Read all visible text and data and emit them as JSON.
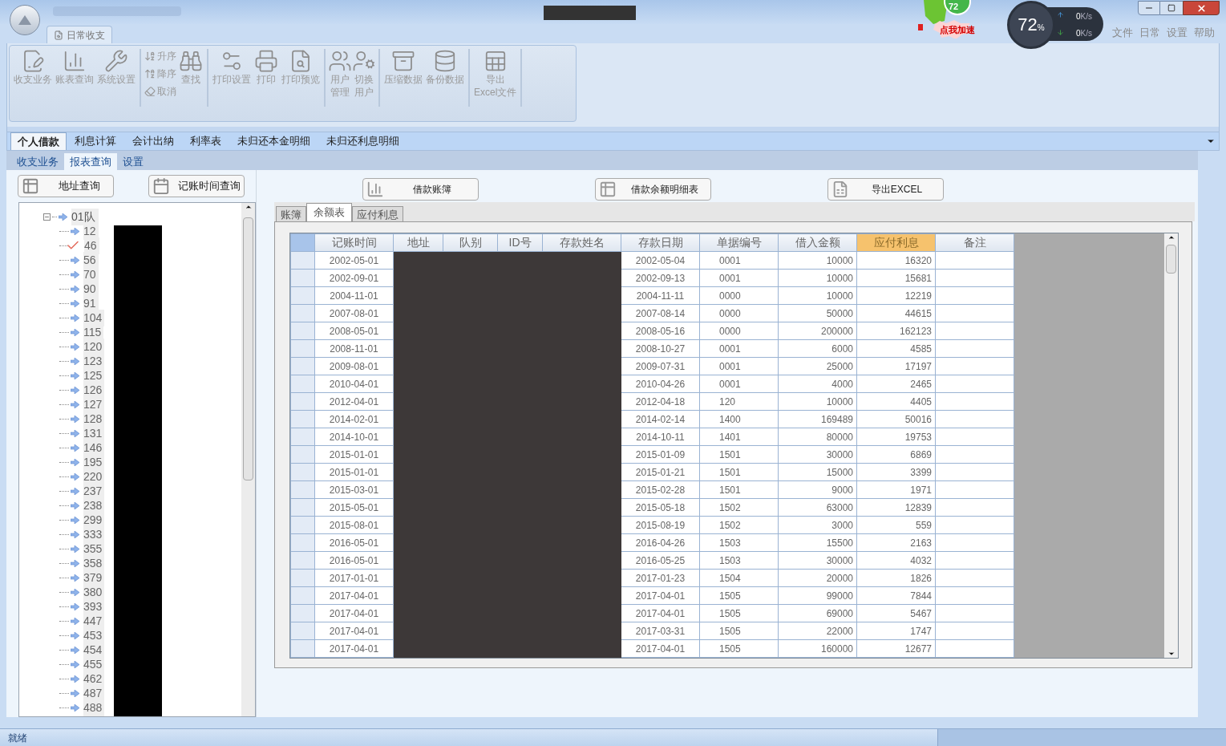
{
  "window": {
    "menu": [
      "文件",
      "日常",
      "设置",
      "帮助"
    ]
  },
  "overlay": {
    "badge": "72",
    "accelerate": "点我加速",
    "cpu": "72",
    "cpu_unit": "%",
    "up": "0",
    "up_unit": "K/s",
    "down": "0",
    "down_unit": "K/s"
  },
  "ribbon": {
    "tab": "日常收支",
    "groups": [
      {
        "kind": "large",
        "buttons": [
          "收支业务",
          "账表查询",
          "系统设置"
        ]
      },
      {
        "kind": "sort",
        "buttons": [
          "升序",
          "降序",
          "取消"
        ],
        "large": "查找"
      },
      {
        "kind": "large",
        "buttons": [
          "打印设置",
          "打印",
          "打印预览"
        ]
      },
      {
        "kind": "large",
        "buttons": [
          "用户管理",
          "切换用户"
        ]
      },
      {
        "kind": "large",
        "buttons": [
          "压缩数据",
          "备份数据"
        ]
      },
      {
        "kind": "large",
        "buttons": [
          "导出\nExcel文件"
        ]
      }
    ]
  },
  "main_tabs": [
    {
      "label": "个人借款",
      "selected": true
    },
    {
      "label": "利息计算",
      "selected": false
    },
    {
      "label": "会计出纳",
      "selected": false
    },
    {
      "label": "利率表",
      "selected": false
    },
    {
      "label": "未归还本金明细",
      "selected": false
    },
    {
      "label": "未归还利息明细",
      "selected": false
    }
  ],
  "sub_tabs": [
    {
      "label": "收支业务",
      "selected": false
    },
    {
      "label": "报表查询",
      "selected": true
    },
    {
      "label": "设置",
      "selected": false
    }
  ],
  "query_buttons": [
    "地址查询",
    "记账时间查询"
  ],
  "report_buttons": [
    "借款账簿",
    "借款余额明细表",
    "导出EXCEL"
  ],
  "tree": {
    "label": "01队",
    "expanded": true,
    "children": [
      {
        "label": "12",
        "checked": false
      },
      {
        "label": "46",
        "checked": true
      },
      {
        "label": "56",
        "checked": false
      },
      {
        "label": "70",
        "checked": false
      },
      {
        "label": "90",
        "checked": false
      },
      {
        "label": "91",
        "checked": false
      },
      {
        "label": "104",
        "checked": false
      },
      {
        "label": "115",
        "checked": false
      },
      {
        "label": "120",
        "checked": false
      },
      {
        "label": "123",
        "checked": false
      },
      {
        "label": "125",
        "checked": false
      },
      {
        "label": "126",
        "checked": false
      },
      {
        "label": "127",
        "checked": false
      },
      {
        "label": "128",
        "checked": false
      },
      {
        "label": "131",
        "checked": false
      },
      {
        "label": "146",
        "checked": false
      },
      {
        "label": "195",
        "checked": false
      },
      {
        "label": "220",
        "checked": false
      },
      {
        "label": "237",
        "checked": false
      },
      {
        "label": "238",
        "checked": false
      },
      {
        "label": "299",
        "checked": false
      },
      {
        "label": "333",
        "checked": false
      },
      {
        "label": "355",
        "checked": false
      },
      {
        "label": "358",
        "checked": false
      },
      {
        "label": "379",
        "checked": false
      },
      {
        "label": "380",
        "checked": false
      },
      {
        "label": "393",
        "checked": false
      },
      {
        "label": "447",
        "checked": false
      },
      {
        "label": "453",
        "checked": false
      },
      {
        "label": "454",
        "checked": false
      },
      {
        "label": "455",
        "checked": false
      },
      {
        "label": "462",
        "checked": false
      },
      {
        "label": "487",
        "checked": false
      },
      {
        "label": "488",
        "checked": false
      }
    ]
  },
  "grid_tabs": [
    {
      "label": "账簿",
      "selected": false
    },
    {
      "label": "余额表",
      "selected": true
    },
    {
      "label": "应付利息",
      "selected": false
    }
  ],
  "table": {
    "columns": [
      {
        "label": "记账时间",
        "selected": false
      },
      {
        "label": "地址",
        "selected": false
      },
      {
        "label": "队别",
        "selected": false
      },
      {
        "label": "ID号",
        "selected": false
      },
      {
        "label": "存款姓名",
        "selected": false
      },
      {
        "label": "存款日期",
        "selected": false
      },
      {
        "label": "单据编号",
        "selected": false
      },
      {
        "label": "借入金额",
        "selected": false
      },
      {
        "label": "应付利息",
        "selected": true
      },
      {
        "label": "备注",
        "selected": false
      }
    ],
    "rows": [
      [
        "2002-05-01",
        "2002-05-04",
        "0001",
        "10000",
        "16320"
      ],
      [
        "2002-09-01",
        "2002-09-13",
        "0001",
        "10000",
        "15681"
      ],
      [
        "2004-11-01",
        "2004-11-11",
        "0000",
        "10000",
        "12219"
      ],
      [
        "2007-08-01",
        "2007-08-14",
        "0000",
        "50000",
        "44615"
      ],
      [
        "2008-05-01",
        "2008-05-16",
        "0000",
        "200000",
        "162123"
      ],
      [
        "2008-11-01",
        "2008-10-27",
        "0001",
        "6000",
        "4585"
      ],
      [
        "2009-08-01",
        "2009-07-31",
        "0001",
        "25000",
        "17197"
      ],
      [
        "2010-04-01",
        "2010-04-26",
        "0001",
        "4000",
        "2465"
      ],
      [
        "2012-04-01",
        "2012-04-18",
        "120",
        "10000",
        "4405"
      ],
      [
        "2014-02-01",
        "2014-02-14",
        "1400",
        "169489",
        "50016"
      ],
      [
        "2014-10-01",
        "2014-10-11",
        "1401",
        "80000",
        "19753"
      ],
      [
        "2015-01-01",
        "2015-01-09",
        "1501",
        "30000",
        "6869"
      ],
      [
        "2015-01-01",
        "2015-01-21",
        "1501",
        "15000",
        "3399"
      ],
      [
        "2015-03-01",
        "2015-02-28",
        "1501",
        "9000",
        "1971"
      ],
      [
        "2015-05-01",
        "2015-05-18",
        "1502",
        "63000",
        "12839"
      ],
      [
        "2015-08-01",
        "2015-08-19",
        "1502",
        "3000",
        "559"
      ],
      [
        "2016-05-01",
        "2016-04-26",
        "1503",
        "15500",
        "2163"
      ],
      [
        "2016-05-01",
        "2016-05-25",
        "1503",
        "30000",
        "4032"
      ],
      [
        "2017-01-01",
        "2017-01-23",
        "1504",
        "20000",
        "1826"
      ],
      [
        "2017-04-01",
        "2017-04-01",
        "1505",
        "99000",
        "7844"
      ],
      [
        "2017-04-01",
        "2017-04-01",
        "1505",
        "69000",
        "5467"
      ],
      [
        "2017-04-01",
        "2017-03-31",
        "1505",
        "22000",
        "1747"
      ],
      [
        "2017-04-01",
        "2017-04-01",
        "1505",
        "160000",
        "12677"
      ]
    ]
  },
  "status_bar": "就绪"
}
